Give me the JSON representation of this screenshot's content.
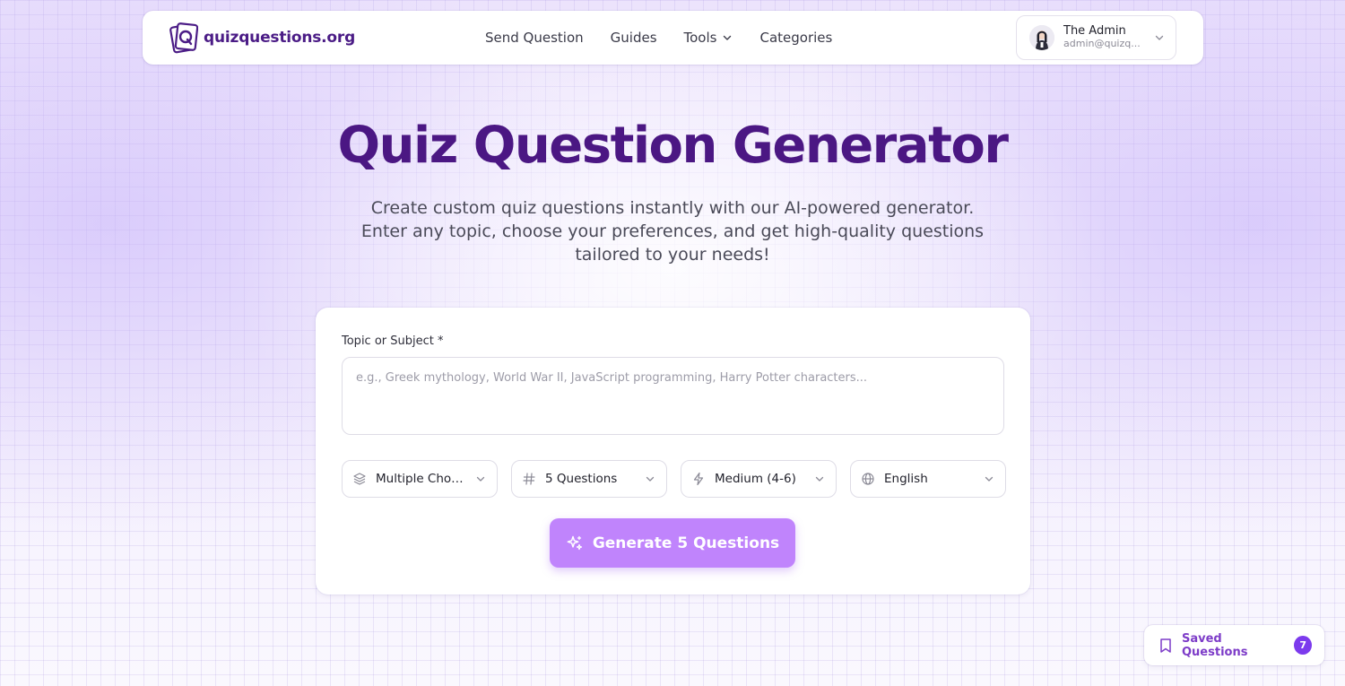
{
  "header": {
    "logo_text": "quizquestions.org",
    "nav": [
      {
        "label": "Send Question"
      },
      {
        "label": "Guides"
      },
      {
        "label": "Tools"
      },
      {
        "label": "Categories"
      }
    ],
    "user": {
      "name": "The Admin",
      "email": "admin@quizq..."
    }
  },
  "hero": {
    "title": "Quiz Question Generator",
    "subtitle": "Create custom quiz questions instantly with our AI-powered generator. Enter any topic, choose your preferences, and get high-quality questions tailored to your needs!"
  },
  "form": {
    "topic_label": "Topic or Subject *",
    "topic_value": "",
    "topic_placeholder": "e.g., Greek mythology, World War II, JavaScript programming, Harry Potter characters...",
    "selects": [
      {
        "icon": "layers-icon",
        "value": "Multiple Choice"
      },
      {
        "icon": "hash-icon",
        "value": "5 Questions"
      },
      {
        "icon": "bolt-icon",
        "value": "Medium (4-6)"
      },
      {
        "icon": "globe-icon",
        "value": "English"
      }
    ],
    "generate_label": "Generate 5 Questions"
  },
  "saved": {
    "label": "Saved Questions",
    "count": "7"
  },
  "colors": {
    "brand": "#4b1783",
    "button": "#c084fc",
    "badge": "#7c3aed"
  }
}
